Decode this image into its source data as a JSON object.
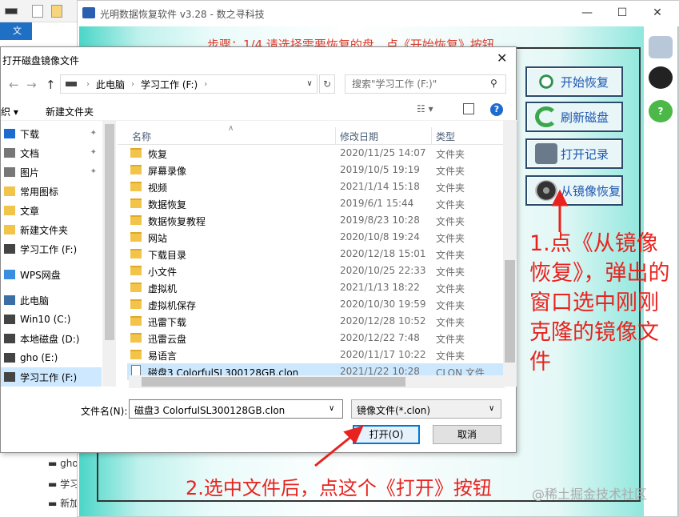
{
  "app": {
    "title": "光明数据恢复软件 v3.28 - 数之寻科技",
    "step_text": "步骤：1/4 请选择需要恢复的盘，点《开始恢复》按钮",
    "buttons": [
      {
        "label": "开始恢复",
        "icon": "magnifier-icon",
        "color": "#2f8f4e"
      },
      {
        "label": "刷新磁盘",
        "icon": "refresh-icon",
        "color": "#3aa84a"
      },
      {
        "label": "打开记录",
        "icon": "camera-icon",
        "color": "#6a7a8a"
      },
      {
        "label": "从镜像恢复",
        "icon": "disk-icon",
        "color": "#333333"
      }
    ],
    "minimize": "—",
    "maximize": "☐",
    "close": "✕"
  },
  "bg_explorer": {
    "tab": "文",
    "drives": [
      "gho",
      "学习",
      "新加"
    ]
  },
  "dialog": {
    "title": "打开磁盘镜像文件",
    "close": "✕",
    "breadcrumb": [
      "此电脑",
      "学习工作 (F:)"
    ],
    "search_placeholder": "搜索\"学习工作 (F:)\"",
    "toolbar": {
      "organize": "织 ▾",
      "new_folder": "新建文件夹"
    },
    "nav_items": [
      {
        "label": "下载",
        "pinned": true
      },
      {
        "label": "文档",
        "pinned": true
      },
      {
        "label": "图片",
        "pinned": true
      },
      {
        "label": "常用图标",
        "pinned": false
      },
      {
        "label": "文章",
        "pinned": false
      },
      {
        "label": "新建文件夹",
        "pinned": false
      },
      {
        "label": "学习工作 (F:)",
        "pinned": false
      },
      {
        "label": "WPS网盘",
        "pinned": false
      },
      {
        "label": "此电脑",
        "pinned": false
      },
      {
        "label": "Win10 (C:)",
        "pinned": false
      },
      {
        "label": "本地磁盘 (D:)",
        "pinned": false
      },
      {
        "label": "gho (E:)",
        "pinned": false
      },
      {
        "label": "学习工作 (F:)",
        "pinned": false
      }
    ],
    "columns": {
      "name": "名称",
      "date": "修改日期",
      "type": "类型"
    },
    "files": [
      {
        "name": "恢复",
        "date": "2020/11/25 14:07",
        "type": "文件夹",
        "kind": "folder"
      },
      {
        "name": "屏幕录像",
        "date": "2019/10/5 19:19",
        "type": "文件夹",
        "kind": "folder"
      },
      {
        "name": "视频",
        "date": "2021/1/14 15:18",
        "type": "文件夹",
        "kind": "folder"
      },
      {
        "name": "数据恢复",
        "date": "2019/6/1 15:44",
        "type": "文件夹",
        "kind": "folder"
      },
      {
        "name": "数据恢复教程",
        "date": "2019/8/23 10:28",
        "type": "文件夹",
        "kind": "folder"
      },
      {
        "name": "网站",
        "date": "2020/10/8 19:24",
        "type": "文件夹",
        "kind": "folder"
      },
      {
        "name": "下载目录",
        "date": "2020/12/18 15:01",
        "type": "文件夹",
        "kind": "folder"
      },
      {
        "name": "小文件",
        "date": "2020/10/25 22:33",
        "type": "文件夹",
        "kind": "folder"
      },
      {
        "name": "虚拟机",
        "date": "2021/1/13 18:22",
        "type": "文件夹",
        "kind": "folder"
      },
      {
        "name": "虚拟机保存",
        "date": "2020/10/30 19:59",
        "type": "文件夹",
        "kind": "folder"
      },
      {
        "name": "迅雷下载",
        "date": "2020/12/28 10:52",
        "type": "文件夹",
        "kind": "folder"
      },
      {
        "name": "迅雷云盘",
        "date": "2020/12/22 7:48",
        "type": "文件夹",
        "kind": "folder"
      },
      {
        "name": "易语言",
        "date": "2020/11/17 10:22",
        "type": "文件夹",
        "kind": "folder"
      },
      {
        "name": "磁盘3 ColorfulSL300128GB.clon",
        "date": "2021/1/22 10:28",
        "type": "CLON 文件",
        "kind": "file"
      }
    ],
    "filename_label": "文件名(N):",
    "filename_value": "磁盘3 ColorfulSL300128GB.clon",
    "filetype_value": "镜像文件(*.clon)",
    "open_label": "打开(O)",
    "cancel_label": "取消"
  },
  "annotations": {
    "note1": "1.点《从镜像恢复》，弹出的窗口选中刚刚克隆的镜像文件",
    "note2": "2.选中文件后，点这个《打开》按钮",
    "watermark": "@稀土掘金技术社区"
  }
}
